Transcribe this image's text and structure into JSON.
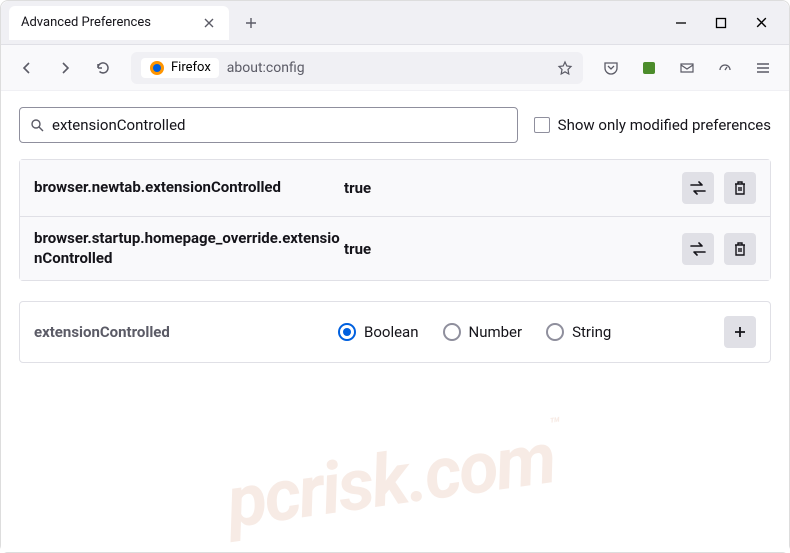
{
  "window": {
    "tab_title": "Advanced Preferences"
  },
  "toolbar": {
    "url_label": "Firefox",
    "url": "about:config"
  },
  "search": {
    "value": "extensionControlled",
    "checkbox_label": "Show only modified preferences"
  },
  "results": [
    {
      "name": "browser.newtab.extensionControlled",
      "value": "true"
    },
    {
      "name": "browser.startup.homepage_override.extensionControlled",
      "value": "true"
    }
  ],
  "add": {
    "name": "extensionControlled",
    "types": [
      "Boolean",
      "Number",
      "String"
    ],
    "selected": "Boolean"
  },
  "watermark": "pcrisk.com"
}
